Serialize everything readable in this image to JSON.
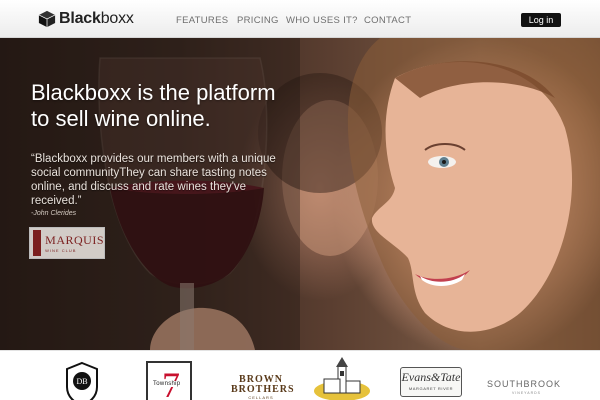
{
  "brand": {
    "name_bold": "Black",
    "name_regular": "boxx"
  },
  "nav": {
    "items": [
      "FEATURES",
      "PRICING",
      "WHO USES IT?",
      "CONTACT"
    ],
    "login": "Log in"
  },
  "hero": {
    "title_line1": "Blackboxx is the platform",
    "title_line2": "to sell wine online.",
    "quote": "“Blackboxx provides our members with a unique social communityThey can share tasting notes online, and discuss and rate wines they've received.”",
    "author": "-John Clerides",
    "testimonial_logo": {
      "name": "MARQUIS",
      "sub": "WINE CLUB"
    }
  },
  "partners": {
    "township": {
      "number": "7",
      "word": "Township"
    },
    "brown_brothers": {
      "line1": "BROWN",
      "line2": "BROTHERS",
      "sub": "CELLARS"
    },
    "evans_tate": {
      "name": "Evans&Tate",
      "sub": "MARGARET RIVER"
    },
    "southbrook": {
      "name": "SOUTHBROOK",
      "sub": "VINEYARDS"
    }
  }
}
